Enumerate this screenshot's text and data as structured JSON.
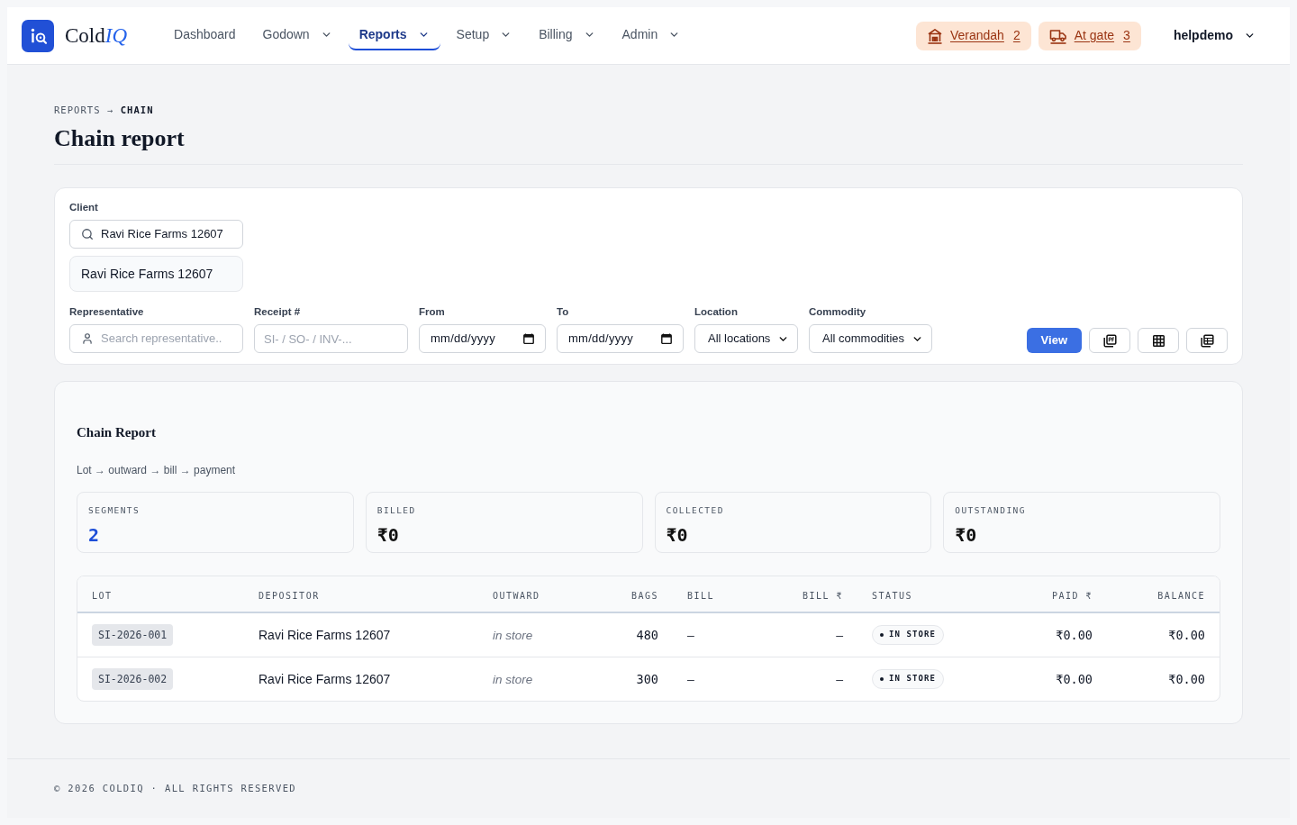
{
  "header": {
    "brand": {
      "name": "Cold",
      "accent": "IQ"
    },
    "nav": [
      {
        "label": "Dashboard",
        "has_menu": false,
        "selected": false
      },
      {
        "label": "Godown",
        "has_menu": true,
        "selected": false
      },
      {
        "label": "Reports",
        "has_menu": true,
        "selected": true
      },
      {
        "label": "Setup",
        "has_menu": true,
        "selected": false
      },
      {
        "label": "Billing",
        "has_menu": true,
        "selected": false
      },
      {
        "label": "Admin",
        "has_menu": true,
        "selected": false
      }
    ],
    "queues": [
      {
        "kind": "verandah",
        "label": "Verandah",
        "count": "2"
      },
      {
        "kind": "gate",
        "label": "At gate",
        "count": "3"
      }
    ],
    "user": "helpdemo"
  },
  "breadcrumb": "REPORTS → **CHAIN**",
  "title": "Chain report",
  "filters": {
    "client": {
      "label": "Client",
      "value": "Ravi Rice Farms 12607",
      "selected": "Ravi Rice Farms 12607"
    },
    "fields": [
      {
        "kind": "person_search",
        "label": "Representative",
        "placeholder": "Search representative.."
      },
      {
        "kind": "text",
        "label": "Receipt #",
        "placeholder": "SI- / SO- / INV-..."
      },
      {
        "kind": "date",
        "label": "From",
        "placeholder": "mm/dd/yyyy"
      },
      {
        "kind": "date",
        "label": "To",
        "placeholder": "mm/dd/yyyy"
      },
      {
        "kind": "select",
        "label": "Location",
        "value": "All locations"
      },
      {
        "kind": "select",
        "label": "Commodity",
        "value": "All commodities"
      }
    ],
    "view_button": "View"
  },
  "report": {
    "title": "Chain Report",
    "subtitle": "Lot → outward → bill → payment",
    "stats": [
      {
        "kind": "count",
        "label": "SEGMENTS",
        "value": "2"
      },
      {
        "kind": "amount",
        "label": "BILLED",
        "value": "₹0"
      },
      {
        "kind": "amount",
        "label": "COLLECTED",
        "value": "₹0"
      },
      {
        "kind": "amount",
        "label": "OUTSTANDING",
        "value": "₹0"
      }
    ],
    "table": {
      "columns": [
        "LOT",
        "DEPOSITOR",
        "OUTWARD",
        "BAGS",
        "BILL",
        "BILL ₹",
        "STATUS",
        "PAID ₹",
        "BALANCE"
      ],
      "rows": [
        {
          "lot": "SI-2026-001",
          "depositor": "Ravi Rice Farms 12607",
          "outward": "in store",
          "bags": "480",
          "bill": "—",
          "bill_amount": "—",
          "status": "IN STORE",
          "paid": "₹0.00",
          "balance": "₹0.00"
        },
        {
          "lot": "SI-2026-002",
          "depositor": "Ravi Rice Farms 12607",
          "outward": "in store",
          "bags": "300",
          "bill": "—",
          "bill_amount": "—",
          "status": "IN STORE",
          "paid": "₹0.00",
          "balance": "₹0.00"
        }
      ]
    }
  },
  "footer": "© 2026 COLDIQ · ALL RIGHTS RESERVED"
}
